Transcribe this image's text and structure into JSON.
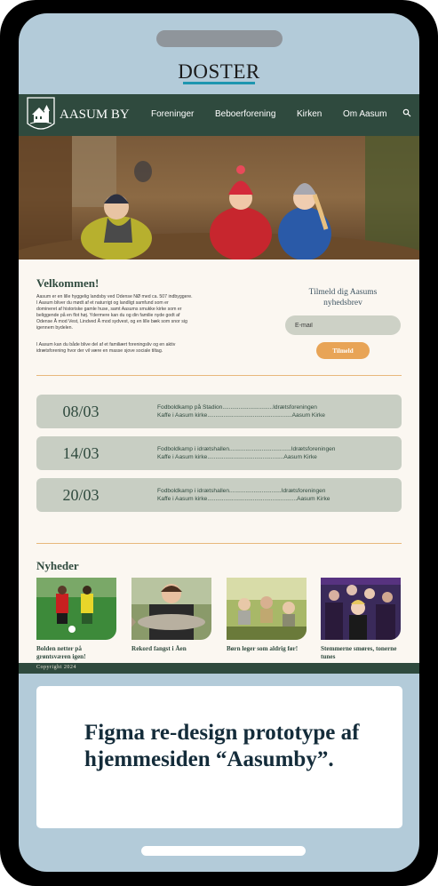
{
  "brand": {
    "name": "DOSTER"
  },
  "site": {
    "logo_text": "AASUM BY",
    "nav": [
      "Foreninger",
      "Beboerforening",
      "Kirken",
      "Om Aasum"
    ],
    "welcome": {
      "title": "Velkommen!",
      "p1_lines": [
        "Aasum er en lille hyggelig landsby ved Odense NØ med ca. 507 indbyggere.",
        "I Aasum bliver du mødt af et naturrigt og landligt samfund som er",
        "domineret af historiske gamle huse, samt Aasums smukke kirke som er",
        "beliggende på en flot høj. Ydermere kan du og din familie nyde godt af",
        "Odense Å mod Vest, Lindved Å mod sydvest, og en lille bæk som snor sig",
        "igennem bydelen."
      ],
      "p2_lines": [
        "I Aasum kan du både blive del af et familiært foreningsliv og en aktiv",
        "idrætsforening hvor der vil være en masse sjove sociale tiltag."
      ]
    },
    "newsletter": {
      "title": "Tilmeld dig Aasums nyhedsbrev",
      "placeholder": "E-mail",
      "button": "Tilmeld"
    },
    "events": [
      {
        "date": "08/03",
        "line1": "Fodboldkamp på Stadion...............................Idrætsforeningen",
        "line2": "Kaffe i Aasum kirke....................................................Aasum Kirke"
      },
      {
        "date": "14/03",
        "line1": "Fodboldkamp i idrætshallen......................................Idrætsforeningen",
        "line2": "Kaffe i Aasum kirke...............................................Aasum Kirke"
      },
      {
        "date": "20/03",
        "line1": "Fodboldkamp i idrætshallen................................Idrætsforeningen",
        "line2": "Kaffe i Aasum kirke.......................................................Aasum Kirke"
      }
    ],
    "news": {
      "title": "Nyheder",
      "items": [
        {
          "caption": "Bolden netter på grøntsværen igen!"
        },
        {
          "caption": "Rekord fangst i Åen"
        },
        {
          "caption": "Børn leger som aldrig før!"
        },
        {
          "caption": "Stemmerne smøres, tonerne tunes"
        }
      ]
    },
    "footer": "Copyright 2024"
  },
  "caption": "Figma re-design prototype af hjemmesiden “Aasumby”."
}
